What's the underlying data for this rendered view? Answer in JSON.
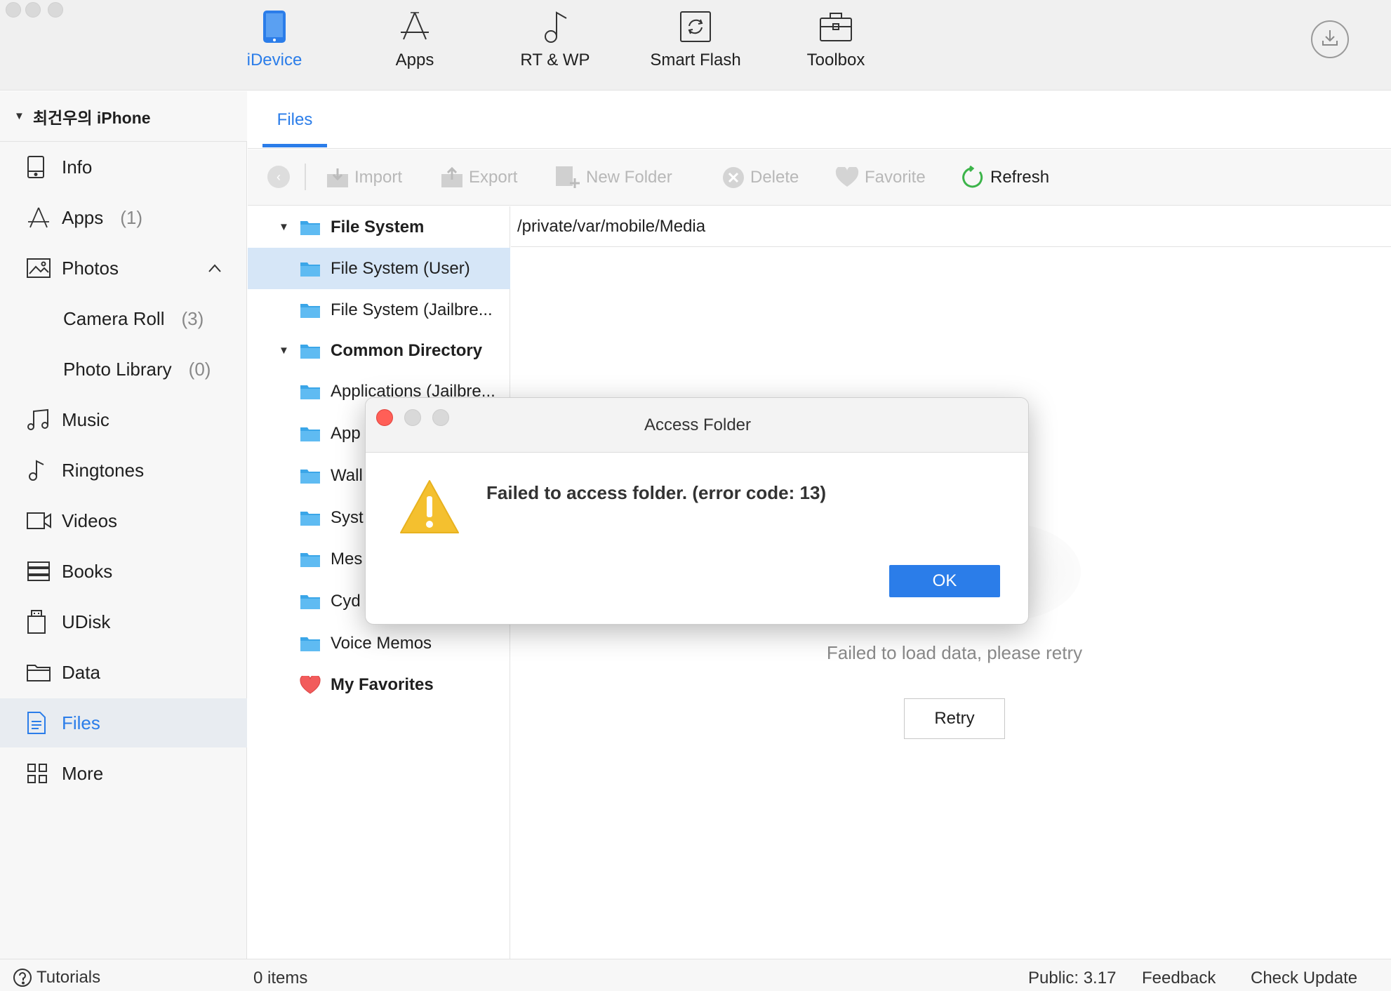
{
  "topnav": [
    {
      "label": "iDevice",
      "icon": "phone-icon",
      "active": true
    },
    {
      "label": "Apps",
      "icon": "app-store-icon"
    },
    {
      "label": "RT & WP",
      "icon": "music-note-icon"
    },
    {
      "label": "Smart Flash",
      "icon": "flash-refresh-icon"
    },
    {
      "label": "Toolbox",
      "icon": "toolbox-icon"
    }
  ],
  "device": {
    "name": "최건우의 iPhone"
  },
  "sidebar": {
    "items": [
      {
        "label": "Info",
        "icon": "info-device-icon",
        "count": ""
      },
      {
        "label": "Apps",
        "icon": "app-store-icon",
        "count": "(1)"
      },
      {
        "label": "Photos",
        "icon": "photo-icon",
        "count": ""
      },
      {
        "label": "Camera Roll",
        "count": "(3)"
      },
      {
        "label": "Photo Library",
        "count": "(0)"
      },
      {
        "label": "Music",
        "icon": "music-icon",
        "count": ""
      },
      {
        "label": "Ringtones",
        "icon": "ringtone-icon",
        "count": ""
      },
      {
        "label": "Videos",
        "icon": "video-icon",
        "count": ""
      },
      {
        "label": "Books",
        "icon": "books-icon",
        "count": ""
      },
      {
        "label": "UDisk",
        "icon": "udisk-icon",
        "count": ""
      },
      {
        "label": "Data",
        "icon": "data-folder-icon",
        "count": ""
      },
      {
        "label": "Files",
        "icon": "files-icon",
        "count": "",
        "active": true
      },
      {
        "label": "More",
        "icon": "grid-icon",
        "count": ""
      }
    ]
  },
  "tabs": [
    {
      "label": "Files"
    }
  ],
  "toolbar": {
    "import": "Import",
    "export": "Export",
    "new_folder": "New Folder",
    "delete": "Delete",
    "favorite": "Favorite",
    "refresh": "Refresh"
  },
  "tree": [
    {
      "label": "File System",
      "bold": true,
      "root": true
    },
    {
      "label": "File System (User)",
      "selected": true
    },
    {
      "label": "File System (Jailbre..."
    },
    {
      "label": "Common Directory",
      "bold": true,
      "root": true
    },
    {
      "label": "Applications (Jailbre..."
    },
    {
      "label": "App"
    },
    {
      "label": "Wall"
    },
    {
      "label": "Syst"
    },
    {
      "label": "Mes"
    },
    {
      "label": "Cyd"
    },
    {
      "label": "Voice Memos"
    },
    {
      "label": "My Favorites",
      "bold": true,
      "favorite": true
    }
  ],
  "path": "/private/var/mobile/Media",
  "content": {
    "error_message": "Failed to load data, please retry",
    "retry_label": "Retry"
  },
  "modal": {
    "title": "Access Folder",
    "message": "Failed to access folder. (error code: 13)",
    "ok_label": "OK"
  },
  "status": {
    "tutorials": "Tutorials",
    "items": "0 items",
    "version": "Public: 3.17",
    "feedback": "Feedback",
    "check_update": "Check Update"
  },
  "colors": {
    "accent": "#2b7de9",
    "warning": "#f4c02f",
    "close_red": "#ff5f57"
  }
}
